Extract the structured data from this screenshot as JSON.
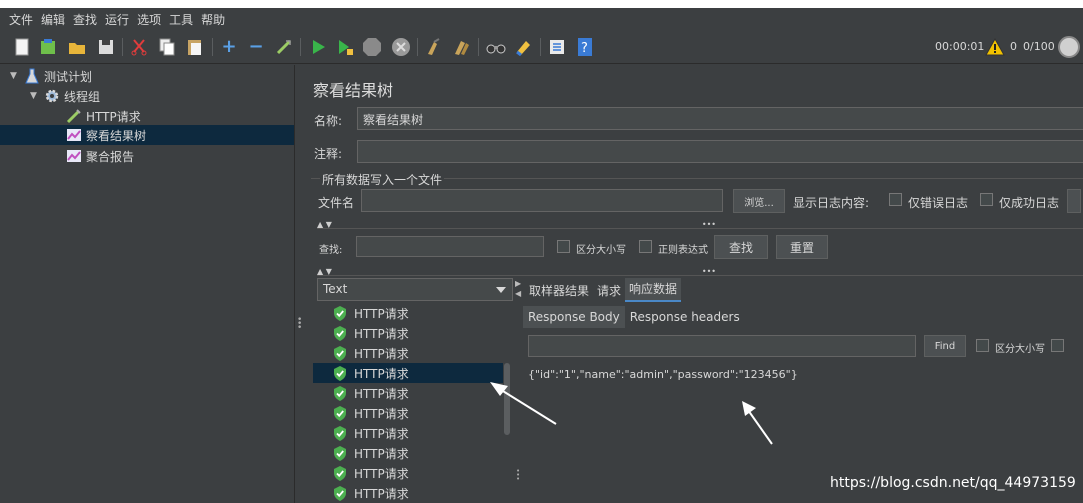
{
  "menubar": {
    "items": [
      "文件",
      "编辑",
      "查找",
      "运行",
      "选项",
      "工具",
      "帮助"
    ]
  },
  "toolbar": {
    "icons": [
      "new-icon",
      "templates-icon",
      "open-icon",
      "save-icon",
      "cut-icon",
      "copy-icon",
      "paste-icon",
      "expand-icon",
      "collapse-icon",
      "toggle-icon",
      "start-icon",
      "start-no-pause-icon",
      "stop-icon",
      "shutdown-icon",
      "clear-icon",
      "clear-all-icon",
      "search-icon",
      "reset-search-icon",
      "function-helper-icon",
      "help-icon"
    ],
    "timer": "00:00:01",
    "warning_count": "0",
    "thread_count": "0/100"
  },
  "tree": {
    "items": [
      {
        "label": "测试计划",
        "icon": "test-plan-icon",
        "arrow": "▼"
      },
      {
        "label": "线程组",
        "icon": "gear-icon",
        "arrow": "▼"
      },
      {
        "label": "HTTP请求",
        "icon": "sampler-pipette-icon",
        "arrow": ""
      },
      {
        "label": "察看结果树",
        "icon": "listener-chart-icon",
        "arrow": ""
      },
      {
        "label": "聚合报告",
        "icon": "listener-chart-icon",
        "arrow": ""
      }
    ]
  },
  "main": {
    "title": "察看结果树",
    "name_label": "名称:",
    "name_value": "察看结果树",
    "comment_label": "注释:",
    "comment_value": "",
    "section_title": "所有数据写入一个文件",
    "filename_label": "文件名",
    "filename_value": "",
    "browse_button": "浏览...",
    "log_label": "显示日志内容:",
    "errors_only": "仅错误日志",
    "success_only": "仅成功日志",
    "search_label": "查找:",
    "search_value": "",
    "case_sensitive": "区分大小写",
    "regex": "正则表达式",
    "search_button": "查找",
    "reset_button": "重置",
    "renderer_value": "Text",
    "results": [
      "HTTP请求",
      "HTTP请求",
      "HTTP请求",
      "HTTP请求",
      "HTTP请求",
      "HTTP请求",
      "HTTP请求",
      "HTTP请求",
      "HTTP请求",
      "HTTP请求"
    ],
    "tabs": [
      "取样器结果",
      "请求",
      "响应数据"
    ],
    "subtabs": [
      "Response Body",
      "Response headers"
    ],
    "find_value": "",
    "find_button": "Find",
    "find_case": "区分大小写",
    "response_body": "{\"id\":\"1\",\"name\":\"admin\",\"password\":\"123456\"}"
  },
  "watermark": "https://blog.csdn.net/qq_44973159",
  "colors": {
    "background": "#3c3f41",
    "selection": "#0d293e",
    "success_green": "#4caf50",
    "warning_yellow": "#f2c200"
  }
}
